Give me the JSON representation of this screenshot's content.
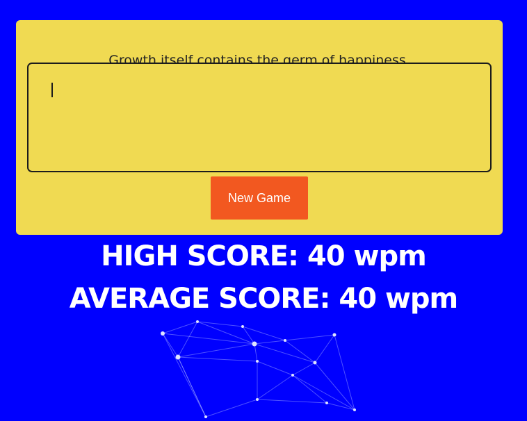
{
  "prompt_text": "Growth itself contains the germ of happiness.",
  "typing_input": {
    "value": ""
  },
  "new_game_label": "New Game",
  "scores": {
    "high": "HIGH SCORE: 40 wpm",
    "average": "AVERAGE SCORE: 40 wpm"
  },
  "colors": {
    "background": "#0000ff",
    "card": "#f0da52",
    "button": "#f25820",
    "text_light": "#ffffff"
  }
}
